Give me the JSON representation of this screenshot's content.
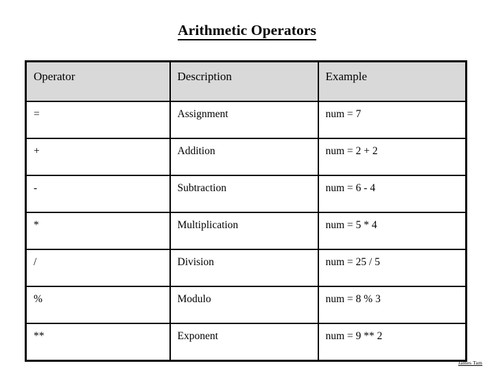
{
  "slide": {
    "title": "Arithmetic Operators",
    "footer_note": "James Tam",
    "background_color": "#ffffff",
    "header_fill": "#d9d9d9",
    "border_color": "#000000"
  },
  "table": {
    "columns": [
      "Operator",
      "Description",
      "Example"
    ],
    "rows": [
      {
        "operator": "=",
        "description": "Assignment",
        "example": "num = 7"
      },
      {
        "operator": "+",
        "description": "Addition",
        "example": "num = 2 + 2"
      },
      {
        "operator": "-",
        "description": "Subtraction",
        "example": "num = 6 - 4"
      },
      {
        "operator": "*",
        "description": "Multiplication",
        "example": "num = 5 * 4"
      },
      {
        "operator": "/",
        "description": "Division",
        "example": "num = 25 / 5"
      },
      {
        "operator": "%",
        "description": "Modulo",
        "example": "num = 8 % 3"
      },
      {
        "operator": "**",
        "description": "Exponent",
        "example": "num = 9 ** 2"
      }
    ]
  }
}
